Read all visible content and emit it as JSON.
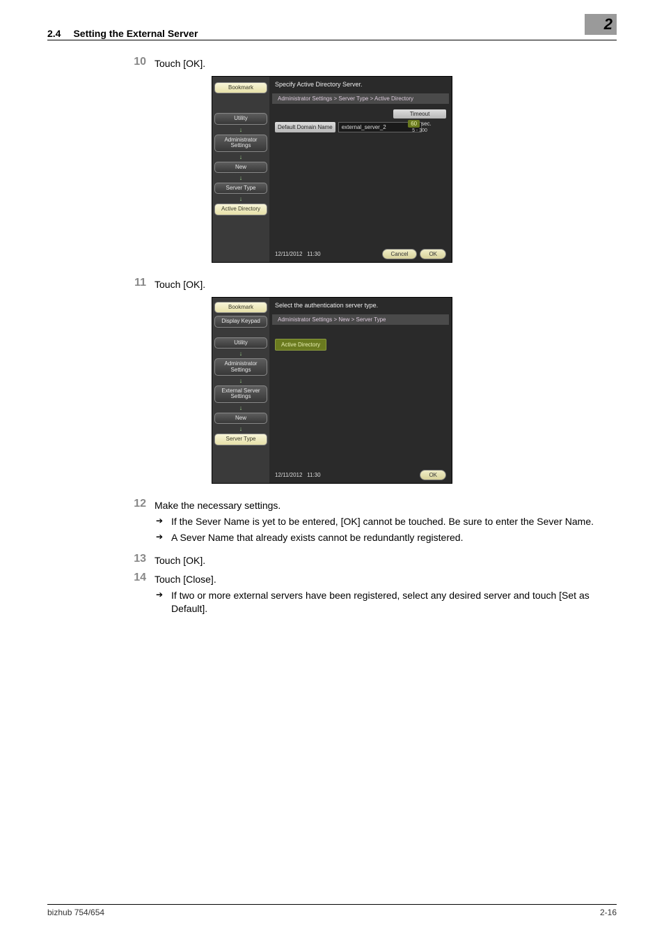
{
  "header": {
    "section_number": "2.4",
    "section_title": "Setting the External Server",
    "chapter": "2"
  },
  "steps": [
    {
      "n": "10",
      "text": "Touch [OK]."
    },
    {
      "n": "11",
      "text": "Touch [OK]."
    },
    {
      "n": "12",
      "text": "Make the necessary settings.",
      "bullets": [
        "If the Sever Name is yet to be entered, [OK] cannot be touched. Be sure to enter the Sever Name.",
        "A Sever Name that already exists cannot be redundantly registered."
      ]
    },
    {
      "n": "13",
      "text": "Touch [OK]."
    },
    {
      "n": "14",
      "text": "Touch [Close].",
      "bullets": [
        "If two or more external servers have been registered, select any desired server and touch [Set as Default]."
      ]
    }
  ],
  "shot1": {
    "title": "Specify Active Directory Server.",
    "crumb": "Administrator Settings > Server Type > Active Directory",
    "left": {
      "bookmark": "Bookmark",
      "utility": "Utility",
      "admin": "Administrator Settings",
      "new": "New",
      "server_type": "Server Type",
      "active_dir": "Active Directory"
    },
    "field_label": "Default Domain Name",
    "field_value": "external_server_2",
    "timeout": {
      "header": "Timeout",
      "value": "60",
      "unit": "sec.",
      "range": "5  -  300"
    },
    "date": "12/11/2012",
    "time": "11:30",
    "btn_cancel": "Cancel",
    "btn_ok": "OK"
  },
  "shot2": {
    "title": "Select the authentication server type.",
    "crumb": "Administrator Settings > New > Server Type",
    "left": {
      "bookmark": "Bookmark",
      "keypad": "Display Keypad",
      "utility": "Utility",
      "admin": "Administrator Settings",
      "ext": "External Server Settings",
      "new": "New",
      "server_type": "Server Type"
    },
    "option": "Active Directory",
    "date": "12/11/2012",
    "time": "11:30",
    "btn_ok": "OK"
  },
  "footer": {
    "left": "bizhub 754/654",
    "right": "2-16"
  }
}
